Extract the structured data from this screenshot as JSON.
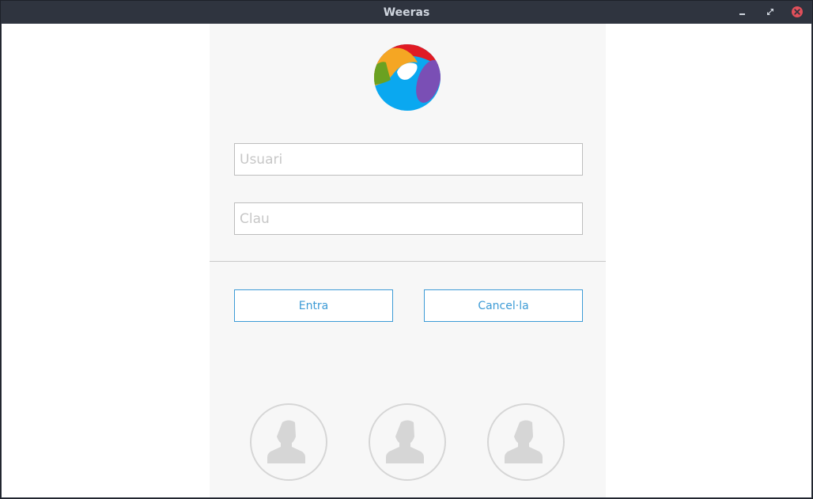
{
  "window": {
    "title": "Weeras",
    "controls": [
      "minimize-icon",
      "maximize-icon",
      "close-icon"
    ],
    "colors": {
      "titlebar": "#2f343f",
      "close": "#e14f5a"
    }
  },
  "logo": {
    "icon": "weeras-logo-icon",
    "colors": [
      "#e01b24",
      "#f5a623",
      "#6aa121",
      "#0aa8f0",
      "#7a4fb5"
    ]
  },
  "login": {
    "username_placeholder": "Usuari",
    "password_placeholder": "Clau",
    "enter_label": "Entra",
    "cancel_label": "Cancel·la",
    "accent": "#3d9bd6"
  },
  "users": [
    {
      "icon": "user-avatar-icon"
    },
    {
      "icon": "user-avatar-icon"
    },
    {
      "icon": "user-avatar-icon"
    }
  ]
}
